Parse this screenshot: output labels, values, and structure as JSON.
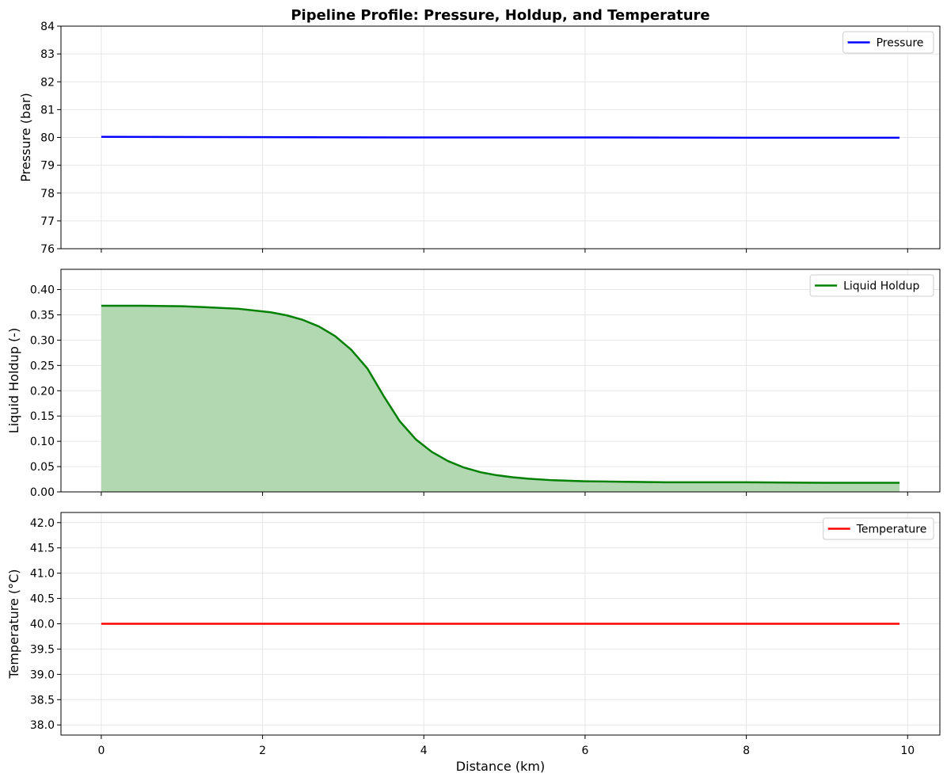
{
  "title": "Pipeline Profile: Pressure, Holdup, and Temperature",
  "colors": {
    "pressure": "#0000ff",
    "holdup": "#008000",
    "holdup_fill": "#b2d8b2",
    "temperature": "#ff0000",
    "grid": "#e6e6e6"
  },
  "chart_data": [
    {
      "type": "line",
      "ylabel": "Pressure (bar)",
      "ylim": [
        76,
        84
      ],
      "yticks": [
        76,
        77,
        78,
        79,
        80,
        81,
        82,
        83,
        84
      ],
      "xlim": [
        -0.5,
        10.4
      ],
      "grid": true,
      "legend_position": "top-right",
      "series": [
        {
          "name": "Pressure",
          "color": "#0000ff",
          "x": [
            0,
            2,
            4,
            6,
            8,
            9.9
          ],
          "y": [
            80.02,
            80.01,
            80.0,
            80.0,
            79.99,
            79.99
          ]
        }
      ]
    },
    {
      "type": "area",
      "ylabel": "Liquid Holdup (-)",
      "ylim": [
        0,
        0.44
      ],
      "yticks": [
        0.0,
        0.05,
        0.1,
        0.15,
        0.2,
        0.25,
        0.3,
        0.35,
        0.4
      ],
      "ytick_labels": [
        "0.00",
        "0.05",
        "0.10",
        "0.15",
        "0.20",
        "0.25",
        "0.30",
        "0.35",
        "0.40"
      ],
      "xlim": [
        -0.5,
        10.4
      ],
      "grid": true,
      "legend_position": "top-right",
      "series": [
        {
          "name": "Liquid Holdup",
          "color": "#008000",
          "x": [
            0,
            0.5,
            1.0,
            1.3,
            1.7,
            2.1,
            2.3,
            2.5,
            2.7,
            2.9,
            3.1,
            3.3,
            3.5,
            3.7,
            3.9,
            4.1,
            4.3,
            4.5,
            4.7,
            4.9,
            5.1,
            5.3,
            5.6,
            6.0,
            6.5,
            7.0,
            8.0,
            9.0,
            9.9
          ],
          "y": [
            0.368,
            0.368,
            0.367,
            0.365,
            0.362,
            0.355,
            0.349,
            0.34,
            0.327,
            0.308,
            0.281,
            0.244,
            0.19,
            0.14,
            0.104,
            0.079,
            0.061,
            0.048,
            0.039,
            0.033,
            0.029,
            0.026,
            0.023,
            0.021,
            0.02,
            0.019,
            0.019,
            0.018,
            0.018
          ]
        }
      ]
    },
    {
      "type": "line",
      "ylabel": "Temperature (°C)",
      "ylim": [
        37.8,
        42.2
      ],
      "yticks": [
        38.0,
        38.5,
        39.0,
        39.5,
        40.0,
        40.5,
        41.0,
        41.5,
        42.0
      ],
      "ytick_labels": [
        "38.0",
        "38.5",
        "39.0",
        "39.5",
        "40.0",
        "40.5",
        "41.0",
        "41.5",
        "42.0"
      ],
      "xlabel": "Distance (km)",
      "xticks": [
        0,
        2,
        4,
        6,
        8,
        10
      ],
      "xlim": [
        -0.5,
        10.4
      ],
      "grid": true,
      "legend_position": "top-right",
      "series": [
        {
          "name": "Temperature",
          "color": "#ff0000",
          "x": [
            0,
            9.9
          ],
          "y": [
            40.0,
            40.0
          ]
        }
      ]
    }
  ]
}
